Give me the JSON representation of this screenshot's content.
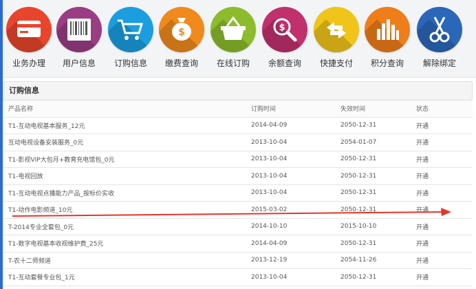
{
  "toolbar": {
    "items": [
      {
        "label": "业务办理",
        "icon": "credit-card-icon",
        "color": "#e8452c"
      },
      {
        "label": "用户信息",
        "icon": "barcode-icon",
        "color": "#9a3d83"
      },
      {
        "label": "订购信息",
        "icon": "shopping-cart-icon",
        "color": "#1a9ee0"
      },
      {
        "label": "缴费查询",
        "icon": "money-bag-icon",
        "color": "#f08a1c"
      },
      {
        "label": "在线订购",
        "icon": "basket-icon",
        "color": "#8cbc2b"
      },
      {
        "label": "余额查询",
        "icon": "dollar-search-icon",
        "color": "#c0306d"
      },
      {
        "label": "快捷支付",
        "icon": "transfer-arrows-icon",
        "color": "#f0c419"
      },
      {
        "label": "积分查询",
        "icon": "bar-chart-icon",
        "color": "#ef7d1a"
      },
      {
        "label": "解除绑定",
        "icon": "scissors-icon",
        "color": "#2a67b8"
      }
    ]
  },
  "panel": {
    "title": "订购信息",
    "columns": [
      "产品名称",
      "订购时间",
      "失效时间",
      "状态"
    ],
    "rows": [
      [
        "T1-互动电视基本服务_12元",
        "2014-04-09",
        "2050-12-31",
        "开通"
      ],
      [
        "互动电视设备安装服务_0元",
        "2013-10-04",
        "2054-01-07",
        "开通"
      ],
      [
        "T1-影视VIP大包月+教育充电馆包_0元",
        "2013-10-04",
        "2050-12-31",
        "开通"
      ],
      [
        "T1-电视回放",
        "2013-10-04",
        "2050-12-31",
        "开通"
      ],
      [
        "T1-互动电视点播能力产品_按标价实收",
        "2013-10-04",
        "2050-12-31",
        "开通"
      ],
      [
        "T1-动作电影频道_10元",
        "2015-03-02",
        "2050-12-31",
        "开通"
      ],
      [
        "T-2014专业全套包_0元",
        "2014-10-10",
        "2015-10-10",
        "开通"
      ],
      [
        "T1-数字电视基本收视维护费_25元",
        "2014-04-09",
        "2050-12-31",
        "开通"
      ],
      [
        "T-农十二师频道",
        "2013-12-19",
        "2054-11-26",
        "开通"
      ],
      [
        "T1-互动套餐专业包_1元",
        "2013-10-04",
        "2050-12-31",
        "开通"
      ]
    ]
  },
  "annotation": {
    "color": "#e8332a"
  },
  "accent": {
    "left_strip": "#2b6bd6"
  }
}
